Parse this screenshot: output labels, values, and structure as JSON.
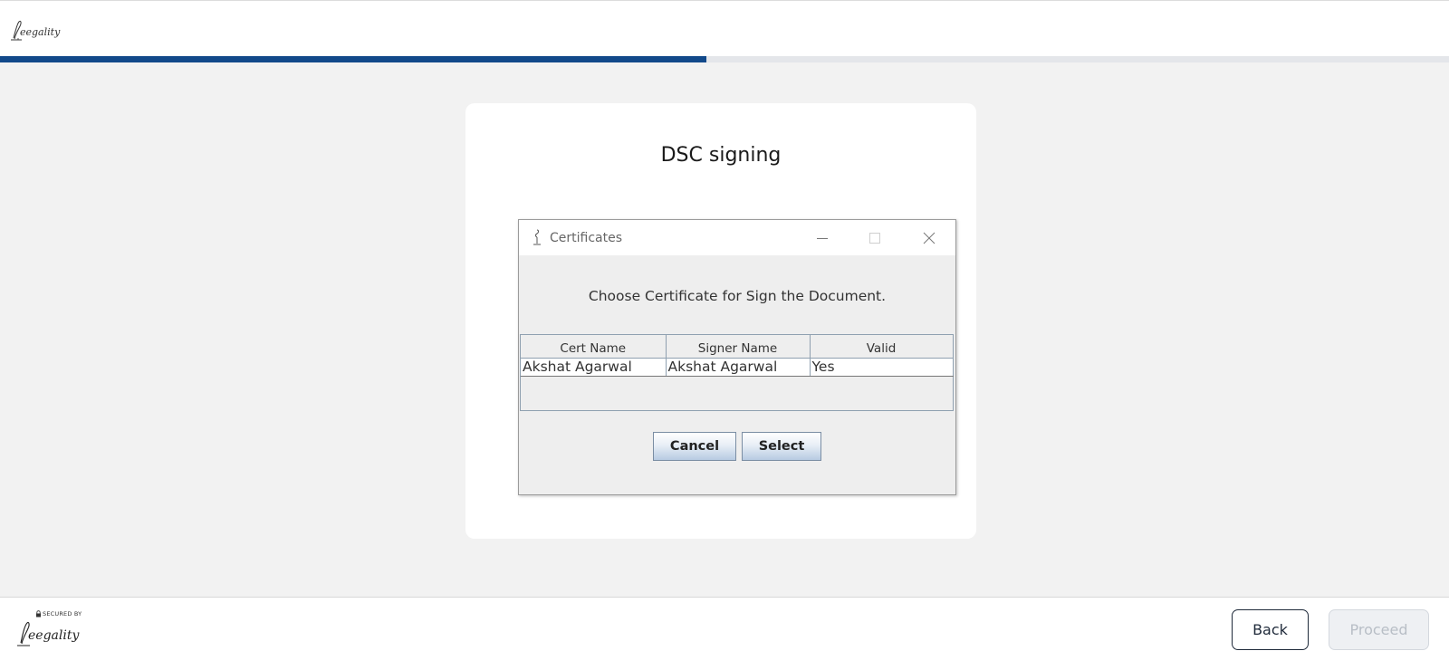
{
  "brand": {
    "logo_text": "Leegality",
    "accent_color": "#12498a"
  },
  "progress": {
    "fraction": 0.4875
  },
  "card": {
    "title": "DSC signing"
  },
  "dialog": {
    "title": "Certificates",
    "prompt": "Choose Certificate for Sign the Document.",
    "table": {
      "columns": [
        "Cert Name",
        "Signer Name",
        "Valid"
      ],
      "rows": [
        [
          "Akshat Agarwal",
          "Akshat Agarwal",
          "Yes"
        ]
      ]
    },
    "cancel_label": "Cancel",
    "select_label": "Select"
  },
  "footer": {
    "secured_label": "SECURED BY",
    "back_label": "Back",
    "proceed_label": "Proceed"
  }
}
